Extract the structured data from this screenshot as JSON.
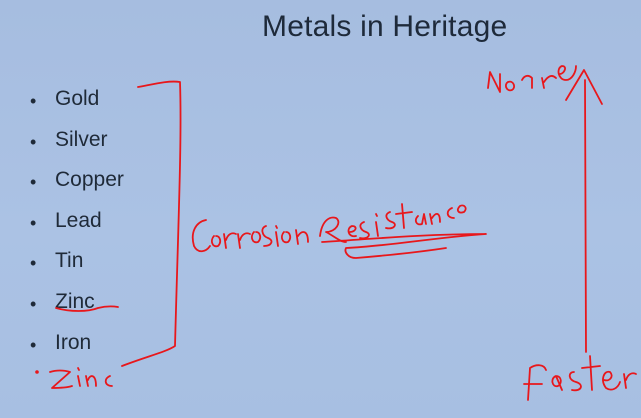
{
  "slide": {
    "title": "Metals in Heritage",
    "bullets": [
      "Gold",
      "Silver",
      "Copper",
      "Lead",
      "Tin",
      "Zinc",
      "Iron"
    ]
  },
  "annotations": {
    "ink_color": "#e8171b",
    "handwritten": [
      "Corrosion Resistance",
      "Noble",
      "Faster",
      "Zinc"
    ]
  }
}
